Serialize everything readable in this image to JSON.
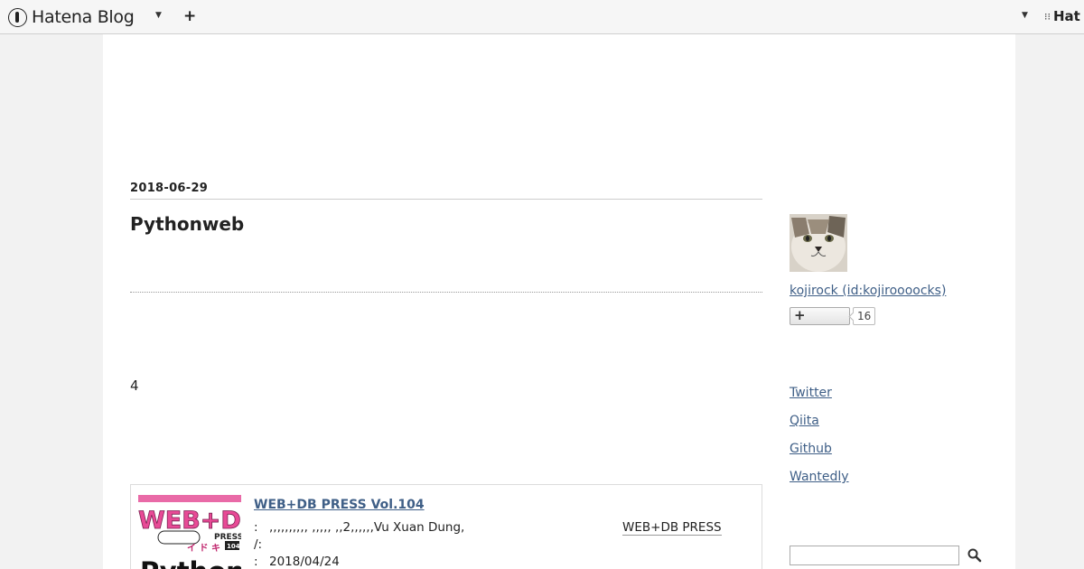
{
  "header": {
    "logo_text": "Hatena Blog",
    "add_label": "+",
    "right_text": "Hat"
  },
  "entry": {
    "date": "2018-06-29",
    "title": "Pythonweb",
    "body_text": "4"
  },
  "book": {
    "title": "WEB+DB PRESS Vol.104",
    "meta_colon": ":",
    "authors": ",,,,,,,,,,                     ,,,,,          ,,2,,,,,,Vu Xuan Dung,",
    "publisher": "WEB+DB PRESS",
    "meta2": "/:",
    "date_colon": ":",
    "date": "2018/04/24",
    "cover_text_main": "WEB+DB",
    "cover_text_press": "PRESS",
    "cover_text_python": "Python",
    "cover_text_vol": "104"
  },
  "sidebar": {
    "profile_link": "kojirock (id:kojiroooocks)",
    "subscribe_label": "+",
    "subscriber_count": "16",
    "links": [
      {
        "label": "Twitter"
      },
      {
        "label": "Qiita"
      },
      {
        "label": "Github"
      },
      {
        "label": "Wantedly"
      }
    ],
    "search": {
      "value": "",
      "placeholder": ""
    }
  },
  "icons": {
    "logo": "hatena-logo-icon",
    "caret": "chevron-down-icon",
    "search": "search-icon"
  }
}
